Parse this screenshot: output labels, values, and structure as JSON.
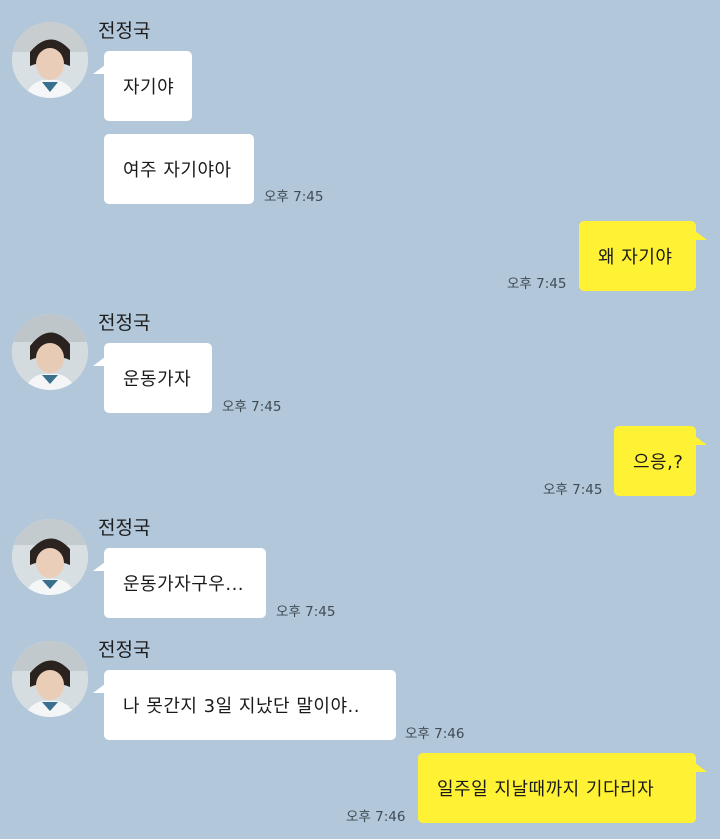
{
  "chat": {
    "colors": {
      "background": "#b2c7da",
      "incoming_bubble": "#ffffff",
      "outgoing_bubble": "#fff235"
    },
    "sender_name": "전정국",
    "messages": [
      {
        "side": "in",
        "text": "자기야",
        "time": ""
      },
      {
        "side": "in",
        "text": "여주 자기야아",
        "time": "오후 7:45"
      },
      {
        "side": "out",
        "text": "왜 자기야",
        "time": "오후 7:45"
      },
      {
        "side": "in",
        "text": "운동가자",
        "time": "오후 7:45"
      },
      {
        "side": "out",
        "text": "으응,?",
        "time": "오후 7:45"
      },
      {
        "side": "in",
        "text": "운동가자구우...",
        "time": "오후 7:45"
      },
      {
        "side": "in",
        "text": "나 못간지 3일 지났단 말이야..",
        "time": "오후 7:46"
      },
      {
        "side": "out",
        "text": "일주일 지날때까지 기다리자",
        "time": "오후 7:46"
      }
    ]
  }
}
